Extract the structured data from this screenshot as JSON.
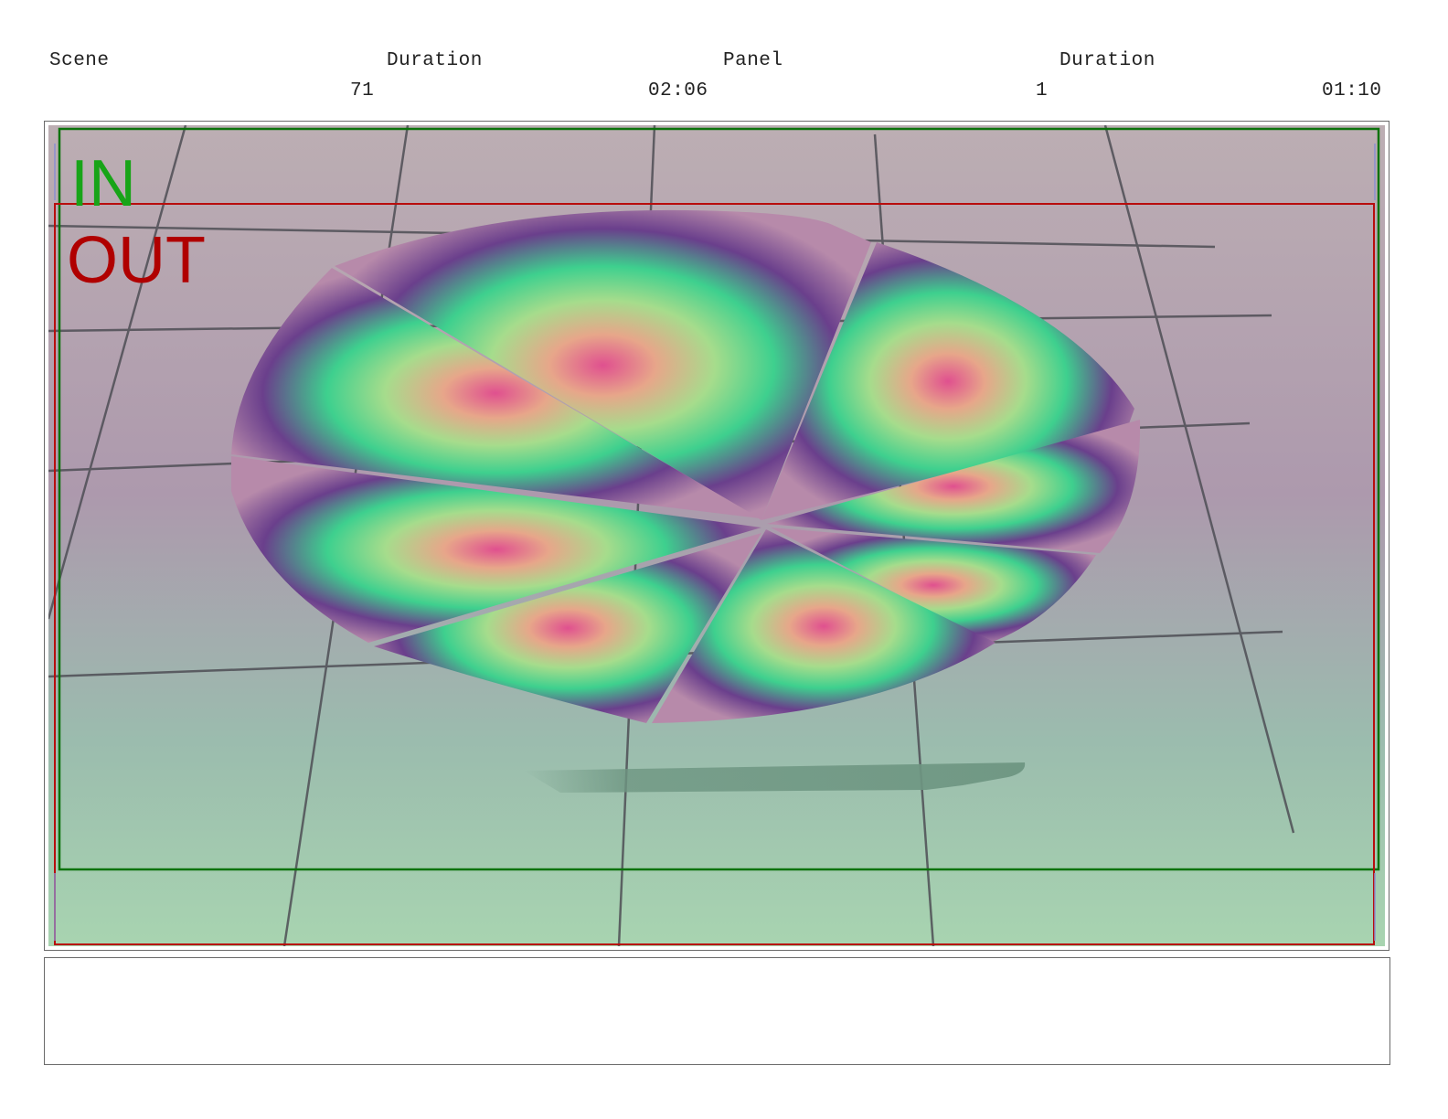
{
  "header": {
    "scene_label": "Scene",
    "scene_duration_label": "Duration",
    "panel_label": "Panel",
    "panel_duration_label": "Duration",
    "scene_value": "71",
    "scene_duration_value": "02:06",
    "panel_value": "1",
    "panel_duration_value": "01:10"
  },
  "frame": {
    "in_label": "IN",
    "out_label": "OUT",
    "in_color": "#18a418",
    "out_color": "#b00000"
  },
  "notes": {
    "text": ""
  }
}
